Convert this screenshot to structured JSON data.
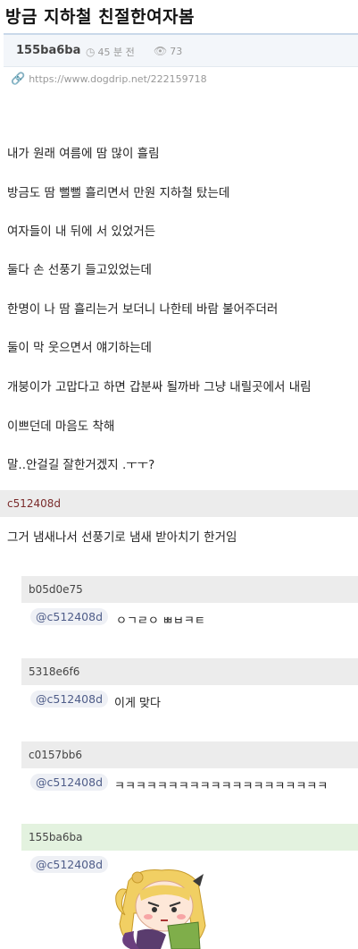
{
  "post": {
    "title": "방금 지하철 친절한여자봄",
    "author": "155ba6ba",
    "time": "45 분 전",
    "views": "73",
    "url": "https://www.dogdrip.net/222159718",
    "lines": [
      "내가 원래 여름에 땀 많이 흘림",
      "방금도 땀 뻘뻘 흘리면서 만원 지하철 탔는데",
      "여자들이 내 뒤에 서 있었거든",
      "둘다 손 선풍기 들고있었는데",
      "한명이 나 땀 흘리는거 보더니  나한테 바람 불어주더러",
      "둘이 막 웃으면서 얘기하는데",
      "개붕이가 고맙다고 하면 갑분싸 될까바  그냥 내릴곳에서 내림",
      "이쁘던데 마음도 착해",
      "말..안걸길 잘한거겠지 .ㅜㅜ?"
    ]
  },
  "comments": {
    "top": {
      "user": "c512408d",
      "text": "그거 냄새나서 선풍기로 냄새 받아치기 한거임"
    },
    "replies": [
      {
        "user": "b05d0e75",
        "mention": "@c512408d",
        "text": "ㅇㄱㄹㅇ ㅃㅂㅋㅌ"
      },
      {
        "user": "5318e6f6",
        "mention": "@c512408d",
        "text": "이게 맞다"
      },
      {
        "user": "c0157bb6",
        "mention": "@c512408d",
        "text": "ㅋㅋㅋㅋㅋㅋㅋㅋㅋㅋㅋㅋㅋㅋㅋㅋㅋㅋㅋㅋ"
      },
      {
        "user": "155ba6ba",
        "mention": "@c512408d",
        "text": ""
      }
    ]
  },
  "colors": {
    "comment_bar": "#ececec",
    "author_reply_bar": "#e3f2df",
    "mention": "#4f5d89"
  },
  "icons": {
    "time": "clock-icon",
    "views": "eye-icon",
    "url": "link-icon"
  }
}
